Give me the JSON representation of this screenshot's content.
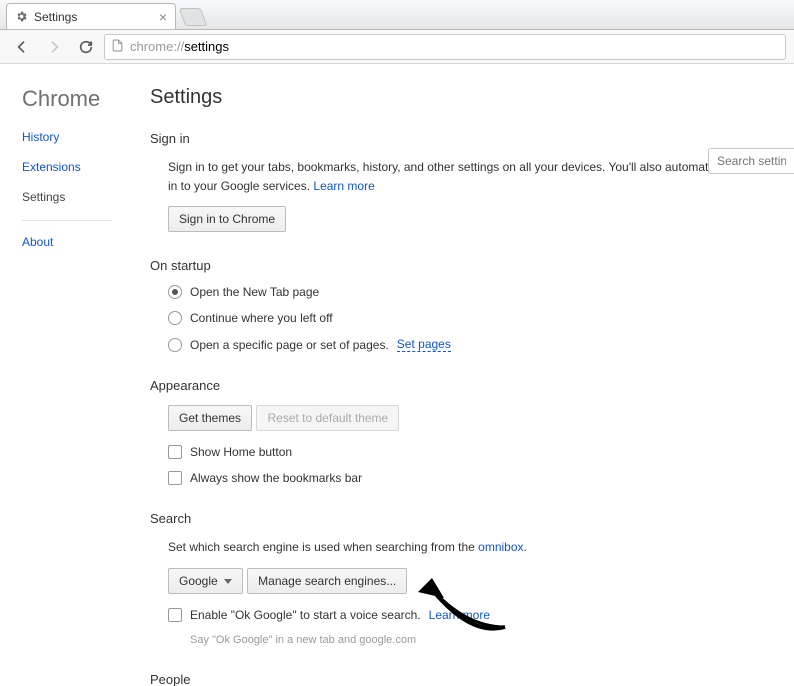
{
  "tab": {
    "title": "Settings"
  },
  "url": {
    "prefix": "chrome://",
    "path": "settings"
  },
  "sidebar": {
    "brand": "Chrome",
    "items": [
      "History",
      "Extensions",
      "Settings"
    ],
    "about": "About"
  },
  "page": {
    "title": "Settings",
    "search_placeholder": "Search setting"
  },
  "signin": {
    "heading": "Sign in",
    "desc1": "Sign in to get your tabs, bookmarks, history, and other settings on all your devices. You'll also automatically be signed in to your Google services. ",
    "learn": "Learn more",
    "button": "Sign in to Chrome"
  },
  "startup": {
    "heading": "On startup",
    "opts": [
      "Open the New Tab page",
      "Continue where you left off",
      "Open a specific page or set of pages. "
    ],
    "set_pages": "Set pages"
  },
  "appearance": {
    "heading": "Appearance",
    "get_themes": "Get themes",
    "reset": "Reset to default theme",
    "checks": [
      "Show Home button",
      "Always show the bookmarks bar"
    ]
  },
  "search": {
    "heading": "Search",
    "desc": "Set which search engine is used when searching from the ",
    "omnibox": "omnibox",
    "engine": "Google",
    "manage": "Manage search engines...",
    "ok_google": "Enable \"Ok Google\" to start a voice search. ",
    "learn": "Learn more",
    "hint": "Say \"Ok Google\" in a new tab and google.com"
  },
  "people": {
    "heading": "People"
  }
}
